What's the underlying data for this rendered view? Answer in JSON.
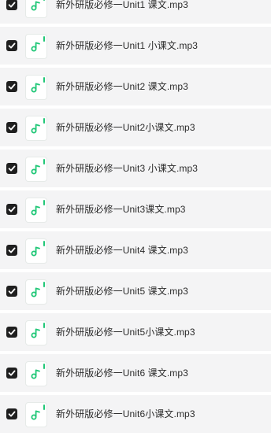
{
  "files": [
    {
      "name": "新外研版必修一Unit1 课文.mp3",
      "checked": true,
      "icon": "music-file-icon"
    },
    {
      "name": "新外研版必修一Unit1 小课文.mp3",
      "checked": true,
      "icon": "music-file-icon"
    },
    {
      "name": "新外研版必修一Unit2 课文.mp3",
      "checked": true,
      "icon": "music-file-icon"
    },
    {
      "name": "新外研版必修一Unit2小课文.mp3",
      "checked": true,
      "icon": "music-file-icon"
    },
    {
      "name": "新外研版必修一Unit3 小课文.mp3",
      "checked": true,
      "icon": "music-file-icon"
    },
    {
      "name": "新外研版必修一Unit3课文.mp3",
      "checked": true,
      "icon": "music-file-icon"
    },
    {
      "name": "新外研版必修一Unit4 课文.mp3",
      "checked": true,
      "icon": "music-file-icon"
    },
    {
      "name": "新外研版必修一Unit5 课文.mp3",
      "checked": true,
      "icon": "music-file-icon"
    },
    {
      "name": "新外研版必修一Unit5小课文.mp3",
      "checked": true,
      "icon": "music-file-icon"
    },
    {
      "name": "新外研版必修一Unit6 课文.mp3",
      "checked": true,
      "icon": "music-file-icon"
    },
    {
      "name": "新外研版必修一Unit6小课文.mp3",
      "checked": true,
      "icon": "music-file-icon"
    }
  ],
  "colors": {
    "row_background": "#f4f4f5",
    "checkbox": "#1f1f1f",
    "audio_icon_accent": "#20c777",
    "text": "#2b2b2b"
  }
}
